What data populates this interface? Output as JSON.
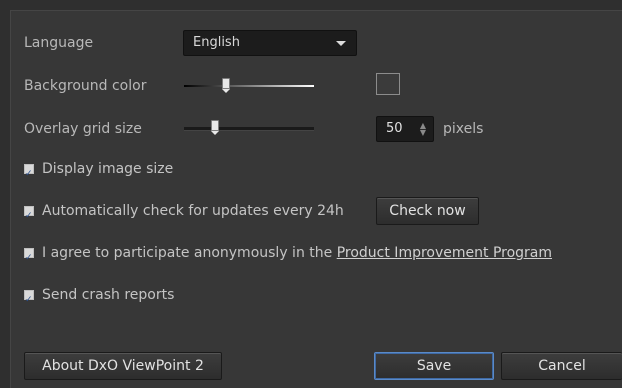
{
  "language": {
    "label": "Language",
    "value": "English"
  },
  "background_color": {
    "label": "Background color",
    "slider_level": 0.32
  },
  "overlay_grid": {
    "label": "Overlay grid size",
    "slider_level": 0.24,
    "value": "50",
    "unit": "pixels"
  },
  "options": {
    "display_image_size": {
      "label": "Display image size",
      "checked": true
    },
    "auto_update": {
      "label": "Automatically check for updates every 24h",
      "checked": true,
      "button": "Check now"
    },
    "improvement": {
      "label_prefix": "I agree to participate anonymously in the",
      "link": "Product Improvement Program",
      "checked": true
    },
    "crash_reports": {
      "label": "Send crash reports",
      "checked": true
    }
  },
  "footer": {
    "about": "About DxO ViewPoint 2",
    "save": "Save",
    "cancel": "Cancel"
  },
  "colors": {
    "background": "#373737",
    "save_border": "#5a8ac8"
  },
  "icons": [
    "chevron-down-icon",
    "checkbox-checked-icon",
    "spinner-arrows-icon",
    "slider-thumb-icon"
  ]
}
